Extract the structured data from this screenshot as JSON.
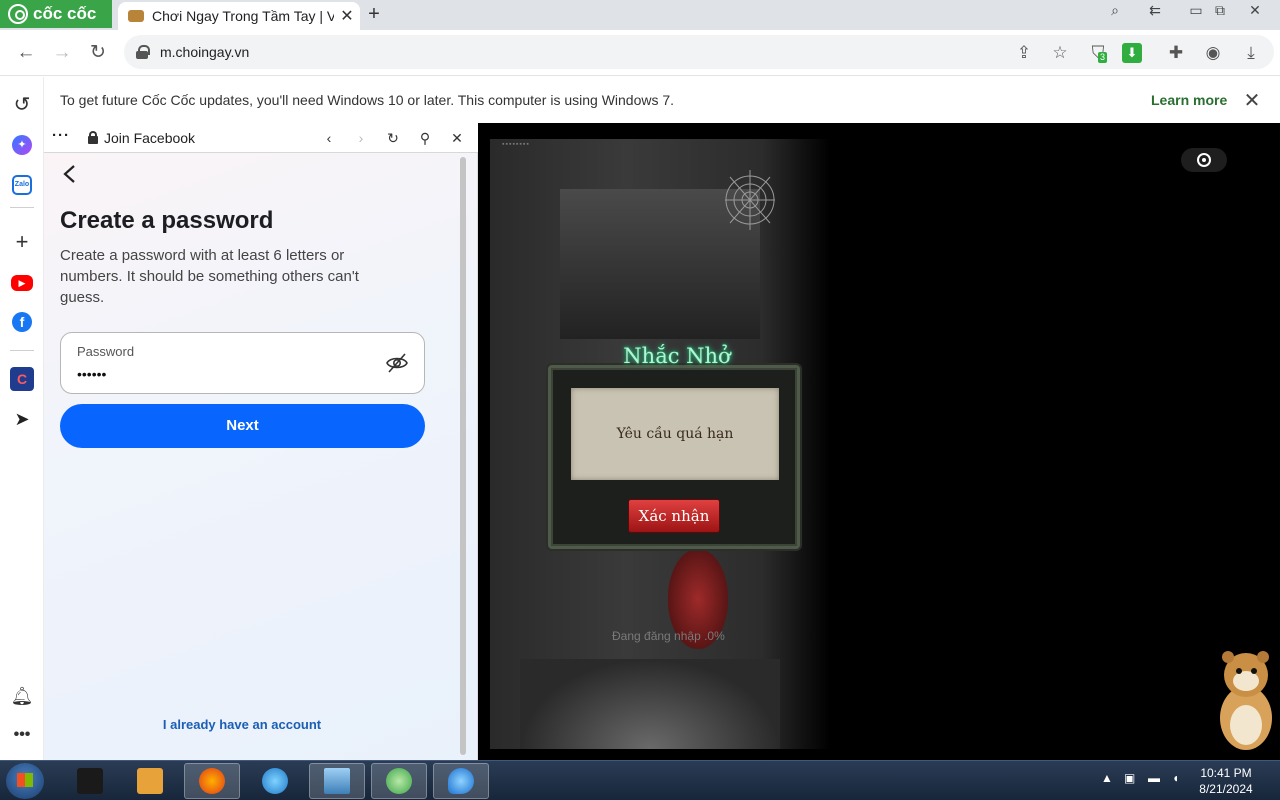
{
  "browser": {
    "brand": "cốc cốc",
    "tab": {
      "title": "Chơi Ngay Trong Tầm Tay | V"
    },
    "url": "m.choingay.vn",
    "extension_badge": "3"
  },
  "notification": {
    "text": "To get future Cốc Cốc updates, you'll need Windows 10 or later. This computer is using Windows 7.",
    "learn_more": "Learn more"
  },
  "side_panel": {
    "title": "Join Facebook"
  },
  "facebook": {
    "heading": "Create a password",
    "description": "Create a password with at least 6 letters or numbers. It should be something others can't guess.",
    "password_label": "Password",
    "password_value": "••••••",
    "next_label": "Next",
    "have_account": "I already have an account"
  },
  "game": {
    "dialog_title": "Nhắc Nhở",
    "dialog_message": "Yêu cầu quá hạn",
    "confirm_label": "Xác nhận",
    "loading_text": "Đang đăng nhập .0%"
  },
  "taskbar": {
    "time": "10:41 PM",
    "date": "8/21/2024"
  },
  "colors": {
    "brand_green": "#3aa548",
    "facebook_blue": "#0866ff",
    "link_blue": "#1a5fb4",
    "taskbar": "#1d2e45"
  }
}
